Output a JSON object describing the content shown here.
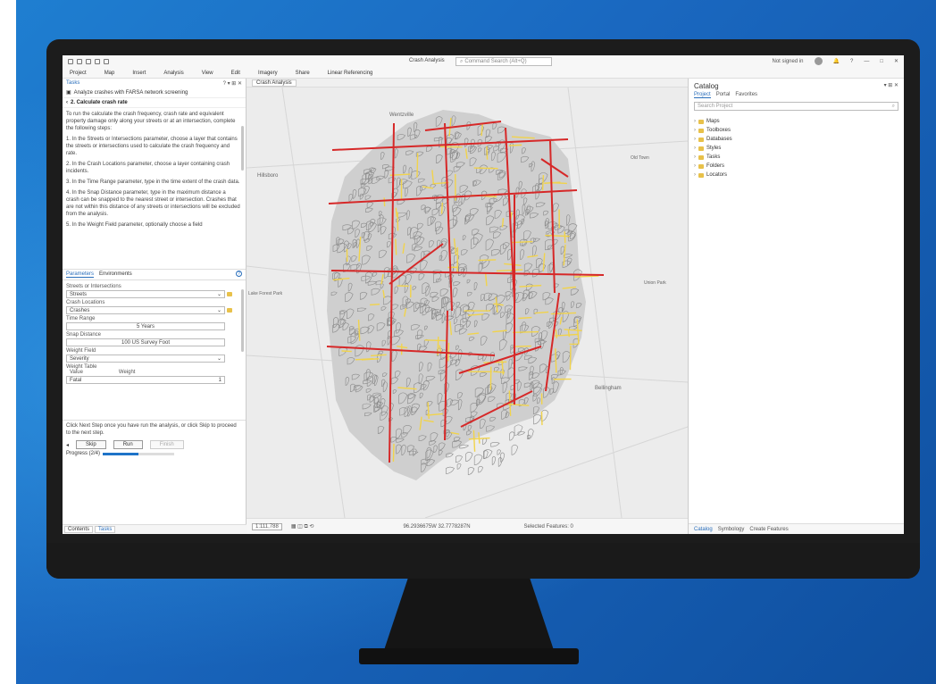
{
  "titlebar": {
    "app_title": "Crash Analysis",
    "search_placeholder": "Command Search (Alt+Q)",
    "sign_in": "Not signed in",
    "help": "?",
    "minimize": "—",
    "maximize": "□",
    "close": "✕"
  },
  "ribbon": [
    "Project",
    "Map",
    "Insert",
    "Analysis",
    "View",
    "Edit",
    "Imagery",
    "Share",
    "Linear Referencing"
  ],
  "tasks": {
    "title": "Tasks",
    "controls": "? ▾ ⊞ ✕",
    "task_name": "Analyze crashes with FARSA network screening",
    "step": "2. Calculate crash rate",
    "instructions": [
      "To run the calculate the crash frequency, crash rate and equivalent property damage only along your streets or at an intersection, complete the following steps:",
      "1. In the Streets or Intersections parameter, choose a layer that contains the streets or intersections used to calculate the crash frequency and rate.",
      "2. In the Crash Locations parameter, choose a layer containing crash incidents.",
      "3. In the Time Range parameter, type in the time extent of the crash data.",
      "4. In the Snap Distance parameter, type in the maximum distance a crash can be snapped to the nearest street or intersection. Crashes that are not within this distance of any streets or intersections will be excluded from the analysis.",
      "5. In the Weight Field parameter, optionally choose a field"
    ],
    "tab_parameters": "Parameters",
    "tab_environments": "Environments",
    "help_icon": "?",
    "params": [
      {
        "label": "Streets or Intersections",
        "value": "Streets"
      },
      {
        "label": "Crash Locations",
        "value": "Crashes"
      },
      {
        "label": "Time Range",
        "value": "5 Years"
      },
      {
        "label": "Snap Distance",
        "value": "100  US Survey Foot"
      },
      {
        "label": "Weight Field",
        "value": "Severity"
      }
    ],
    "weight_table_label": "Weight Table",
    "weight_col_value": "Value",
    "weight_col_weight": "Weight",
    "weight_row_value": "Fatal",
    "weight_row_weight": "1",
    "bottom_text": "Click Next Step once you have run the analysis, or click Skip to proceed to the next step.",
    "nav_back": "◂",
    "skip": "Skip",
    "run": "Run",
    "finish": "Finish",
    "progress_label": "Progress (2/4)",
    "progress": 0.5,
    "bottom_tabs": [
      "Contents",
      "Tasks"
    ]
  },
  "map": {
    "tab": "Crash Analysis",
    "labels": [
      {
        "text": "Wentzville"
      },
      {
        "text": "Hillsboro"
      },
      {
        "text": "Lake Forest Park"
      },
      {
        "text": "Bellingham"
      },
      {
        "text": "Old Town"
      },
      {
        "text": "Union Park"
      }
    ],
    "scale": "1:111,788",
    "coords": "96.2936675W 32.7778287N",
    "selected": "Selected Features: 0"
  },
  "catalog": {
    "title": "Catalog",
    "controls": "▾ ⊞ ✕",
    "tabs": [
      "Project",
      "Portal",
      "Favorites"
    ],
    "search_placeholder": "Search Project",
    "items": [
      "Maps",
      "Toolboxes",
      "Databases",
      "Styles",
      "Tasks",
      "Folders",
      "Locators"
    ],
    "bottom_tabs": [
      "Catalog",
      "Symbology",
      "Create Features"
    ]
  },
  "colors": {
    "accent": "#2a6ebb",
    "major_road": "#d62828",
    "minor_road": "#f1d34b",
    "street": "#8a8a8a"
  }
}
